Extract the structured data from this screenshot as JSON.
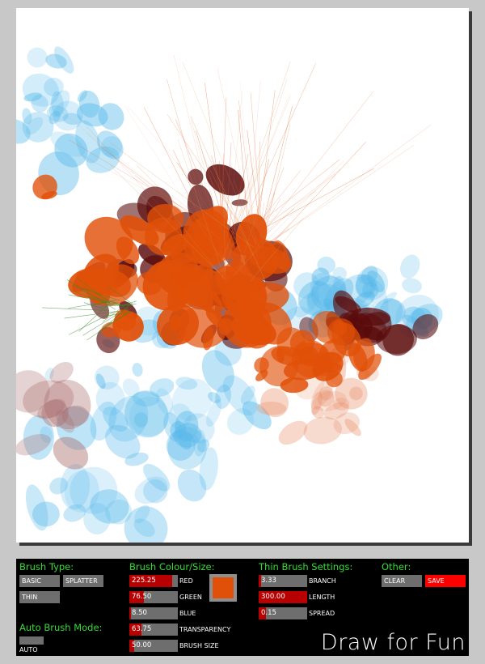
{
  "canvas": {
    "name": "drawing-canvas"
  },
  "panel": {
    "brush_type": {
      "heading": "Brush Type:",
      "buttons": [
        "BASIC",
        "SPLATTER",
        "THIN"
      ]
    },
    "auto_mode": {
      "heading": "Auto Brush Mode:",
      "label": "AUTO"
    },
    "colour": {
      "heading": "Brush Colour/Size:",
      "sliders": [
        {
          "value": "225.25",
          "label": "RED",
          "fraction": 0.88
        },
        {
          "value": "76.50",
          "label": "GREEN",
          "fraction": 0.3
        },
        {
          "value": "8.50",
          "label": "BLUE",
          "fraction": 0.03
        },
        {
          "value": "63.75",
          "label": "TRANSPARENCY",
          "fraction": 0.25
        },
        {
          "value": "50.00",
          "label": "BRUSH SIZE",
          "fraction": 0.1
        }
      ],
      "swatch_color": "#e15008"
    },
    "thin": {
      "heading": "Thin Brush Settings:",
      "sliders": [
        {
          "value": "3.33",
          "label": "BRANCH",
          "fraction": 0.05
        },
        {
          "value": "300.00",
          "label": "LENGTH",
          "fraction": 1.0
        },
        {
          "value": "0.15",
          "label": "SPREAD",
          "fraction": 0.15
        }
      ]
    },
    "other": {
      "heading": "Other:",
      "clear": "CLEAR",
      "save": "SAVE"
    },
    "brand": "Draw for Fun"
  },
  "colors": {
    "heading": "#33dd33",
    "slider_fill": "#b80000",
    "save": "#ff0000",
    "paint_orange": "#e15008",
    "paint_blue": "#55b8ea",
    "paint_maroon": "#5a0a0a"
  }
}
